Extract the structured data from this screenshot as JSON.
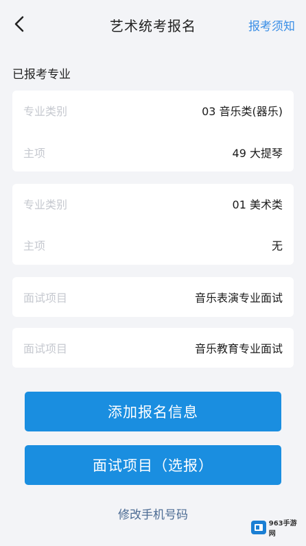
{
  "header": {
    "title": "艺术统考报名",
    "notice_link": "报考须知"
  },
  "section": {
    "label": "已报考专业"
  },
  "cards": [
    {
      "rows": [
        {
          "label": "专业类别",
          "value": "03 音乐类(器乐)"
        },
        {
          "label": "主项",
          "value": "49 大提琴"
        }
      ]
    },
    {
      "rows": [
        {
          "label": "专业类别",
          "value": "01 美术类"
        },
        {
          "label": "主项",
          "value": "无"
        }
      ]
    },
    {
      "rows": [
        {
          "label": "面试项目",
          "value": "音乐表演专业面试"
        }
      ]
    },
    {
      "rows": [
        {
          "label": "面试项目",
          "value": "音乐教育专业面试"
        }
      ]
    }
  ],
  "buttons": {
    "add_info": "添加报名信息",
    "interview": "面试项目（选报）"
  },
  "footer": {
    "change_phone": "修改手机号码"
  },
  "watermark": {
    "text": "963手游网"
  },
  "colors": {
    "accent": "#1a8ee0",
    "link": "#3a8ee6",
    "background": "#f3f4f7"
  }
}
